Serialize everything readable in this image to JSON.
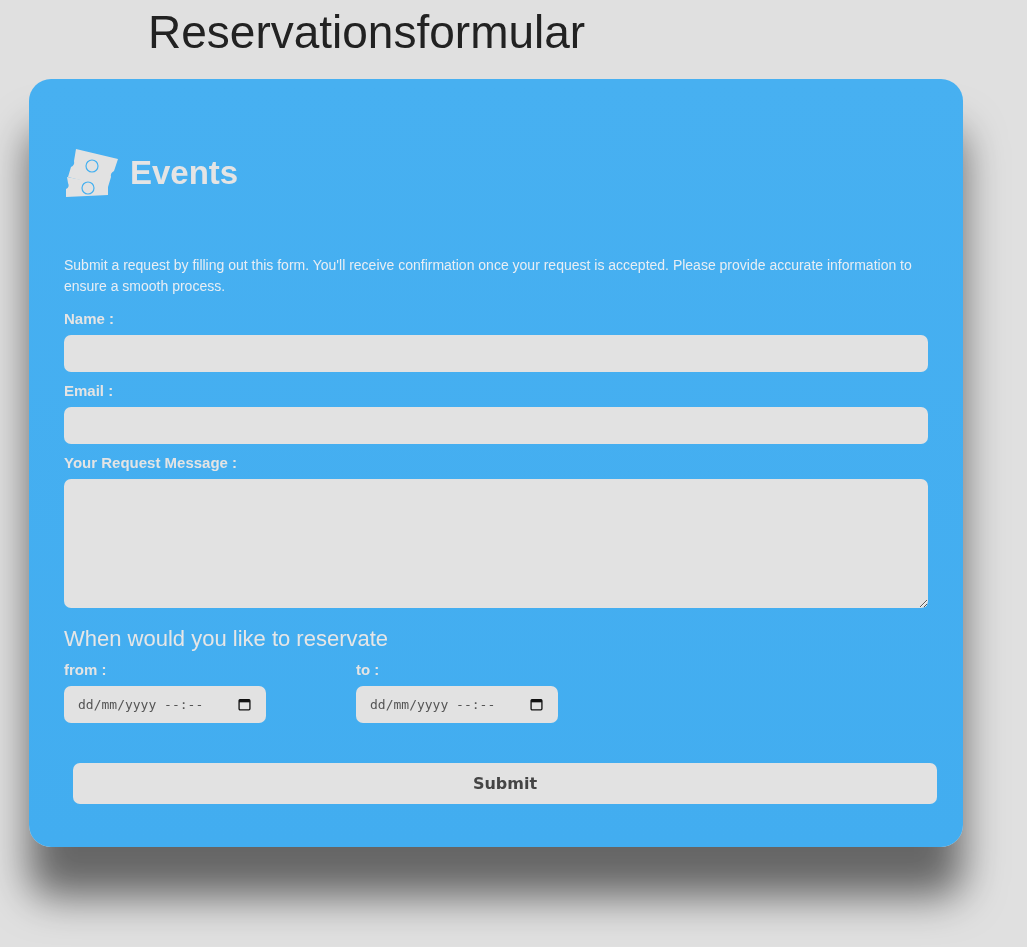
{
  "page_title": "Reservationsformular",
  "card": {
    "brand": "Events",
    "intro": "Submit a request by filling out this form. You'll receive confirmation once your request is accepted. Please provide accurate information to ensure a smooth process.",
    "fields": [
      {
        "label": "Name :",
        "kind": "text"
      },
      {
        "label": "Email :",
        "kind": "text"
      },
      {
        "label": "Your Request Message :",
        "kind": "textarea"
      }
    ],
    "reservation": {
      "heading": "When would you like to reservate",
      "dates": [
        {
          "label": "from :",
          "placeholder": "dd/mm/yyyy --:--"
        },
        {
          "label": "to :",
          "placeholder": "dd/mm/yyyy --:--"
        }
      ]
    },
    "submit": "Submit"
  }
}
